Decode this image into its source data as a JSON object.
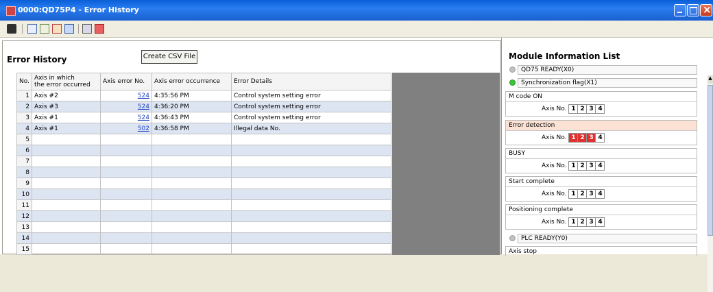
{
  "window": {
    "title": "0000:QD75P4 - Error History"
  },
  "toolbar": {
    "icons": [
      "connect-icon",
      "monitor-icon",
      "history-icon",
      "error-history-icon",
      "table-icon",
      "print-icon",
      "chart-icon"
    ]
  },
  "error_history": {
    "title": "Error History",
    "csv_button": "Create CSV File",
    "columns": [
      "No.",
      "Axis in which\nthe error occurred",
      "Axis error No.",
      "Axis error occurrence",
      "Error Details"
    ],
    "rows": [
      {
        "no": "1",
        "axis": "Axis #2",
        "err": "524",
        "time": "4:35:56 PM",
        "detail": "Control system setting error"
      },
      {
        "no": "2",
        "axis": "Axis #3",
        "err": "524",
        "time": "4:36:20 PM",
        "detail": "Control system setting error"
      },
      {
        "no": "3",
        "axis": "Axis #1",
        "err": "524",
        "time": "4:36:43 PM",
        "detail": "Control system setting error"
      },
      {
        "no": "4",
        "axis": "Axis #1",
        "err": "502",
        "time": "4:36:58 PM",
        "detail": "Illegal data No."
      },
      {
        "no": "5",
        "axis": "",
        "err": "",
        "time": "",
        "detail": ""
      },
      {
        "no": "6",
        "axis": "",
        "err": "",
        "time": "",
        "detail": ""
      },
      {
        "no": "7",
        "axis": "",
        "err": "",
        "time": "",
        "detail": ""
      },
      {
        "no": "8",
        "axis": "",
        "err": "",
        "time": "",
        "detail": ""
      },
      {
        "no": "9",
        "axis": "",
        "err": "",
        "time": "",
        "detail": ""
      },
      {
        "no": "10",
        "axis": "",
        "err": "",
        "time": "",
        "detail": ""
      },
      {
        "no": "11",
        "axis": "",
        "err": "",
        "time": "",
        "detail": ""
      },
      {
        "no": "12",
        "axis": "",
        "err": "",
        "time": "",
        "detail": ""
      },
      {
        "no": "13",
        "axis": "",
        "err": "",
        "time": "",
        "detail": ""
      },
      {
        "no": "14",
        "axis": "",
        "err": "",
        "time": "",
        "detail": ""
      },
      {
        "no": "15",
        "axis": "",
        "err": "",
        "time": "",
        "detail": ""
      }
    ]
  },
  "module_info": {
    "title": "Module Information List",
    "axis_label": "Axis No.",
    "axes": [
      "1",
      "2",
      "3",
      "4"
    ],
    "qd75_ready": "QD75 READY(X0)",
    "sync_flag": "Synchronization flag(X1)",
    "m_code": "M code ON",
    "error_detection": "Error detection",
    "error_axes_on": [
      "1",
      "2",
      "3"
    ],
    "busy": "BUSY",
    "start_complete": "Start complete",
    "positioning_complete": "Positioning complete",
    "plc_ready": "PLC READY(Y0)",
    "axis_stop": "Axis stop",
    "colors": {
      "error_on": "#e03030",
      "led_on": "#3ac83a",
      "led_off": "#c0c0c0"
    }
  }
}
